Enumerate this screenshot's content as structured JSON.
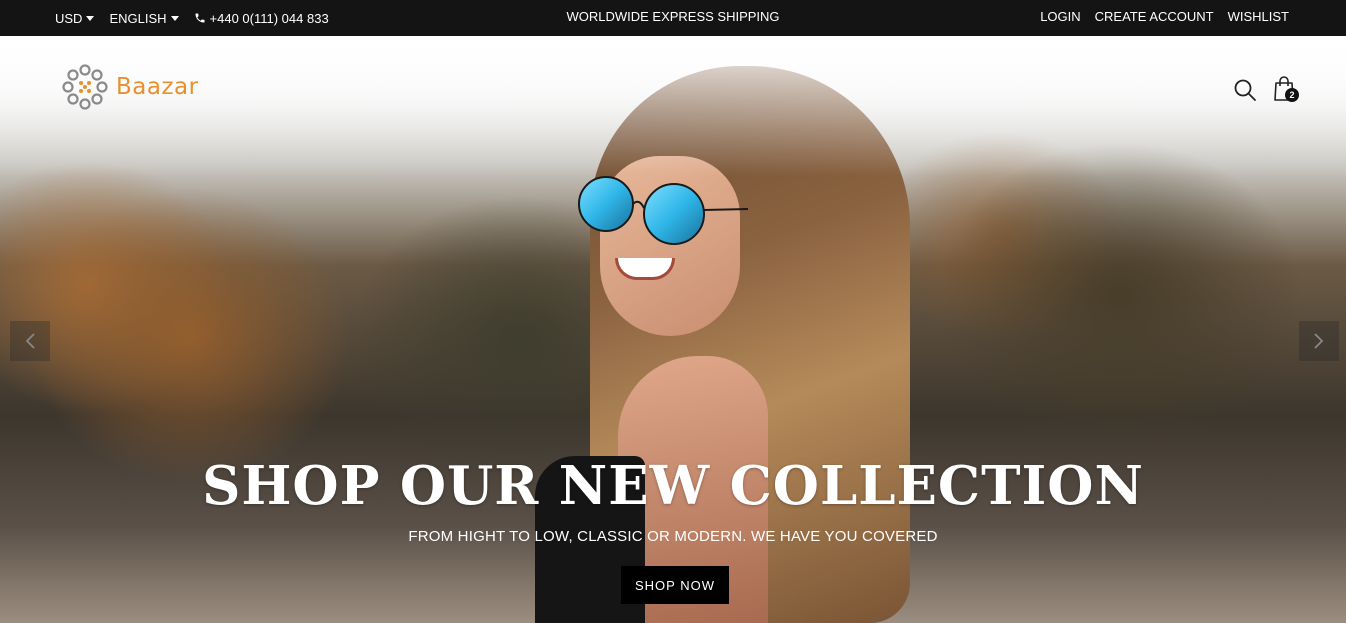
{
  "topbar": {
    "currency": "USD",
    "language": "ENGLISH",
    "phone": "+440 0(111) 044 833",
    "shipping_notice": "WORLDWIDE EXPRESS SHIPPING",
    "links": {
      "login": "LOGIN",
      "create_account": "CREATE ACCOUNT",
      "wishlist": "WISHLIST"
    }
  },
  "header": {
    "logo_text": "Baazar",
    "cart_count": "2",
    "brand_color": "#e8902e"
  },
  "hero": {
    "title": "SHOP OUR NEW COLLECTION",
    "subtitle": "FROM HIGHT TO LOW, CLASSIC OR MODERN. WE HAVE YOU COVERED",
    "cta_label": "SHOP NOW"
  }
}
